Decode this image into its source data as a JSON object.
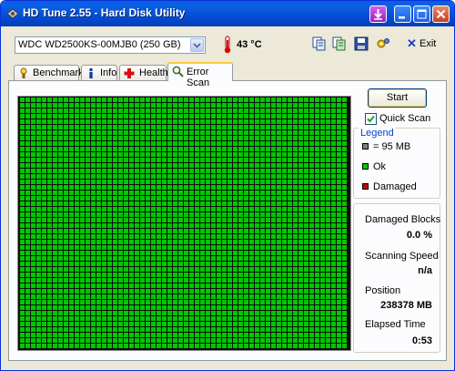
{
  "window": {
    "title": "HD Tune 2.55 - Hard Disk Utility"
  },
  "toolbar": {
    "drive": "WDC WD2500KS-00MJB0 (250 GB)",
    "temperature": "43 °C",
    "exit_label": "Exit"
  },
  "tabs": [
    {
      "label": "Benchmark",
      "icon": "benchmark-icon"
    },
    {
      "label": "Info",
      "icon": "info-icon"
    },
    {
      "label": "Health",
      "icon": "health-icon"
    },
    {
      "label": "Error Scan",
      "icon": "error-scan-icon",
      "active": true
    }
  ],
  "scan": {
    "start_label": "Start",
    "quick_scan_label": "Quick Scan",
    "quick_scan_checked": true,
    "block_grid": {
      "ok_fraction": 1.0,
      "ok_color": "#00c800",
      "damaged_color": "#c80000",
      "unscanned_color": "#808080"
    }
  },
  "legend": {
    "title": "Legend",
    "items": [
      {
        "label": "= 95 MB",
        "color": "#808080"
      },
      {
        "label": "Ok",
        "color": "#00c800"
      },
      {
        "label": "Damaged",
        "color": "#c80000"
      }
    ]
  },
  "stats": {
    "damaged_blocks_label": "Damaged Blocks",
    "damaged_blocks_value": "0.0 %",
    "scanning_speed_label": "Scanning Speed",
    "scanning_speed_value": "n/a",
    "position_label": "Position",
    "position_value": "238378 MB",
    "elapsed_label": "Elapsed Time",
    "elapsed_value": "0:53"
  }
}
